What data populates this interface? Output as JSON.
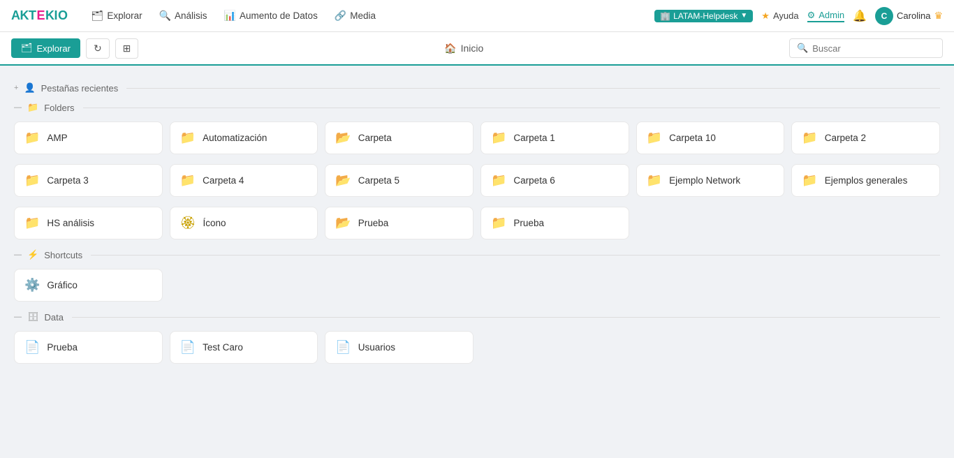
{
  "logo": {
    "text": "AKTEKIO"
  },
  "nav": {
    "items": [
      {
        "id": "explorar",
        "label": "Explorar",
        "icon": "🗂"
      },
      {
        "id": "analisis",
        "label": "Análisis",
        "icon": "🔍"
      },
      {
        "id": "aumento",
        "label": "Aumento de Datos",
        "icon": "📊"
      },
      {
        "id": "media",
        "label": "Media",
        "icon": "🔗"
      }
    ],
    "right": {
      "workspace": "LATAM-Helpdesk",
      "ayuda": "Ayuda",
      "admin": "Admin",
      "user": "Carolina"
    }
  },
  "toolbar": {
    "explorar_label": "Explorar",
    "refresh_icon": "↻",
    "tree_icon": "⊞",
    "home_icon": "🏠",
    "home_label": "Inicio",
    "search_placeholder": "Buscar"
  },
  "sections": {
    "recent_tabs": {
      "label": "Pestañas recientes",
      "toggle": "+"
    },
    "folders": {
      "label": "Folders",
      "toggle": "—"
    },
    "shortcuts": {
      "label": "Shortcuts",
      "toggle": "—"
    },
    "data": {
      "label": "Data",
      "toggle": "—"
    }
  },
  "folders": [
    {
      "id": "amp",
      "name": "AMP",
      "color": "folder-teal",
      "icon": "📁"
    },
    {
      "id": "automatizacion",
      "name": "Automatización",
      "color": "folder-teal",
      "icon": "📁"
    },
    {
      "id": "carpeta",
      "name": "Carpeta",
      "color": "folder-gray",
      "icon": "📁"
    },
    {
      "id": "carpeta1",
      "name": "Carpeta 1",
      "color": "folder-teal",
      "icon": "📁"
    },
    {
      "id": "carpeta10",
      "name": "Carpeta 10",
      "color": "folder-dark-teal",
      "icon": "📁"
    },
    {
      "id": "carpeta2",
      "name": "Carpeta 2",
      "color": "folder-teal",
      "icon": "📁"
    },
    {
      "id": "carpeta3",
      "name": "Carpeta 3",
      "color": "folder-teal",
      "icon": "📁"
    },
    {
      "id": "carpeta4",
      "name": "Carpeta 4",
      "color": "folder-teal",
      "icon": "📁"
    },
    {
      "id": "carpeta5",
      "name": "Carpeta 5",
      "color": "folder-gray",
      "icon": "📁"
    },
    {
      "id": "carpeta6",
      "name": "Carpeta 6",
      "color": "folder-teal",
      "icon": "📁"
    },
    {
      "id": "ejemplonetwork",
      "name": "Ejemplo Network",
      "color": "folder-teal",
      "icon": "📁"
    },
    {
      "id": "ejemplosgenerales",
      "name": "Ejemplos generales",
      "color": "folder-teal",
      "icon": "📁"
    },
    {
      "id": "hsanalisis",
      "name": "HS análisis",
      "color": "folder-teal",
      "icon": "📁"
    },
    {
      "id": "icono",
      "name": "Ícono",
      "color": "folder-gold",
      "icon": "📁"
    },
    {
      "id": "prueba",
      "name": "Prueba",
      "color": "folder-gray",
      "icon": "📁"
    },
    {
      "id": "prueba2",
      "name": "Prueba",
      "color": "folder-red",
      "icon": "📁"
    }
  ],
  "shortcuts": [
    {
      "id": "grafico",
      "name": "Gráfico",
      "icon": "⚙️",
      "color": "folder-teal"
    }
  ],
  "data_items": [
    {
      "id": "prueba-data",
      "name": "Prueba",
      "icon": "📄",
      "color": "folder-orange"
    },
    {
      "id": "testcaro",
      "name": "Test Caro",
      "icon": "📄",
      "color": "folder-orange"
    },
    {
      "id": "usuarios",
      "name": "Usuarios",
      "icon": "📄",
      "color": "folder-orange"
    }
  ]
}
